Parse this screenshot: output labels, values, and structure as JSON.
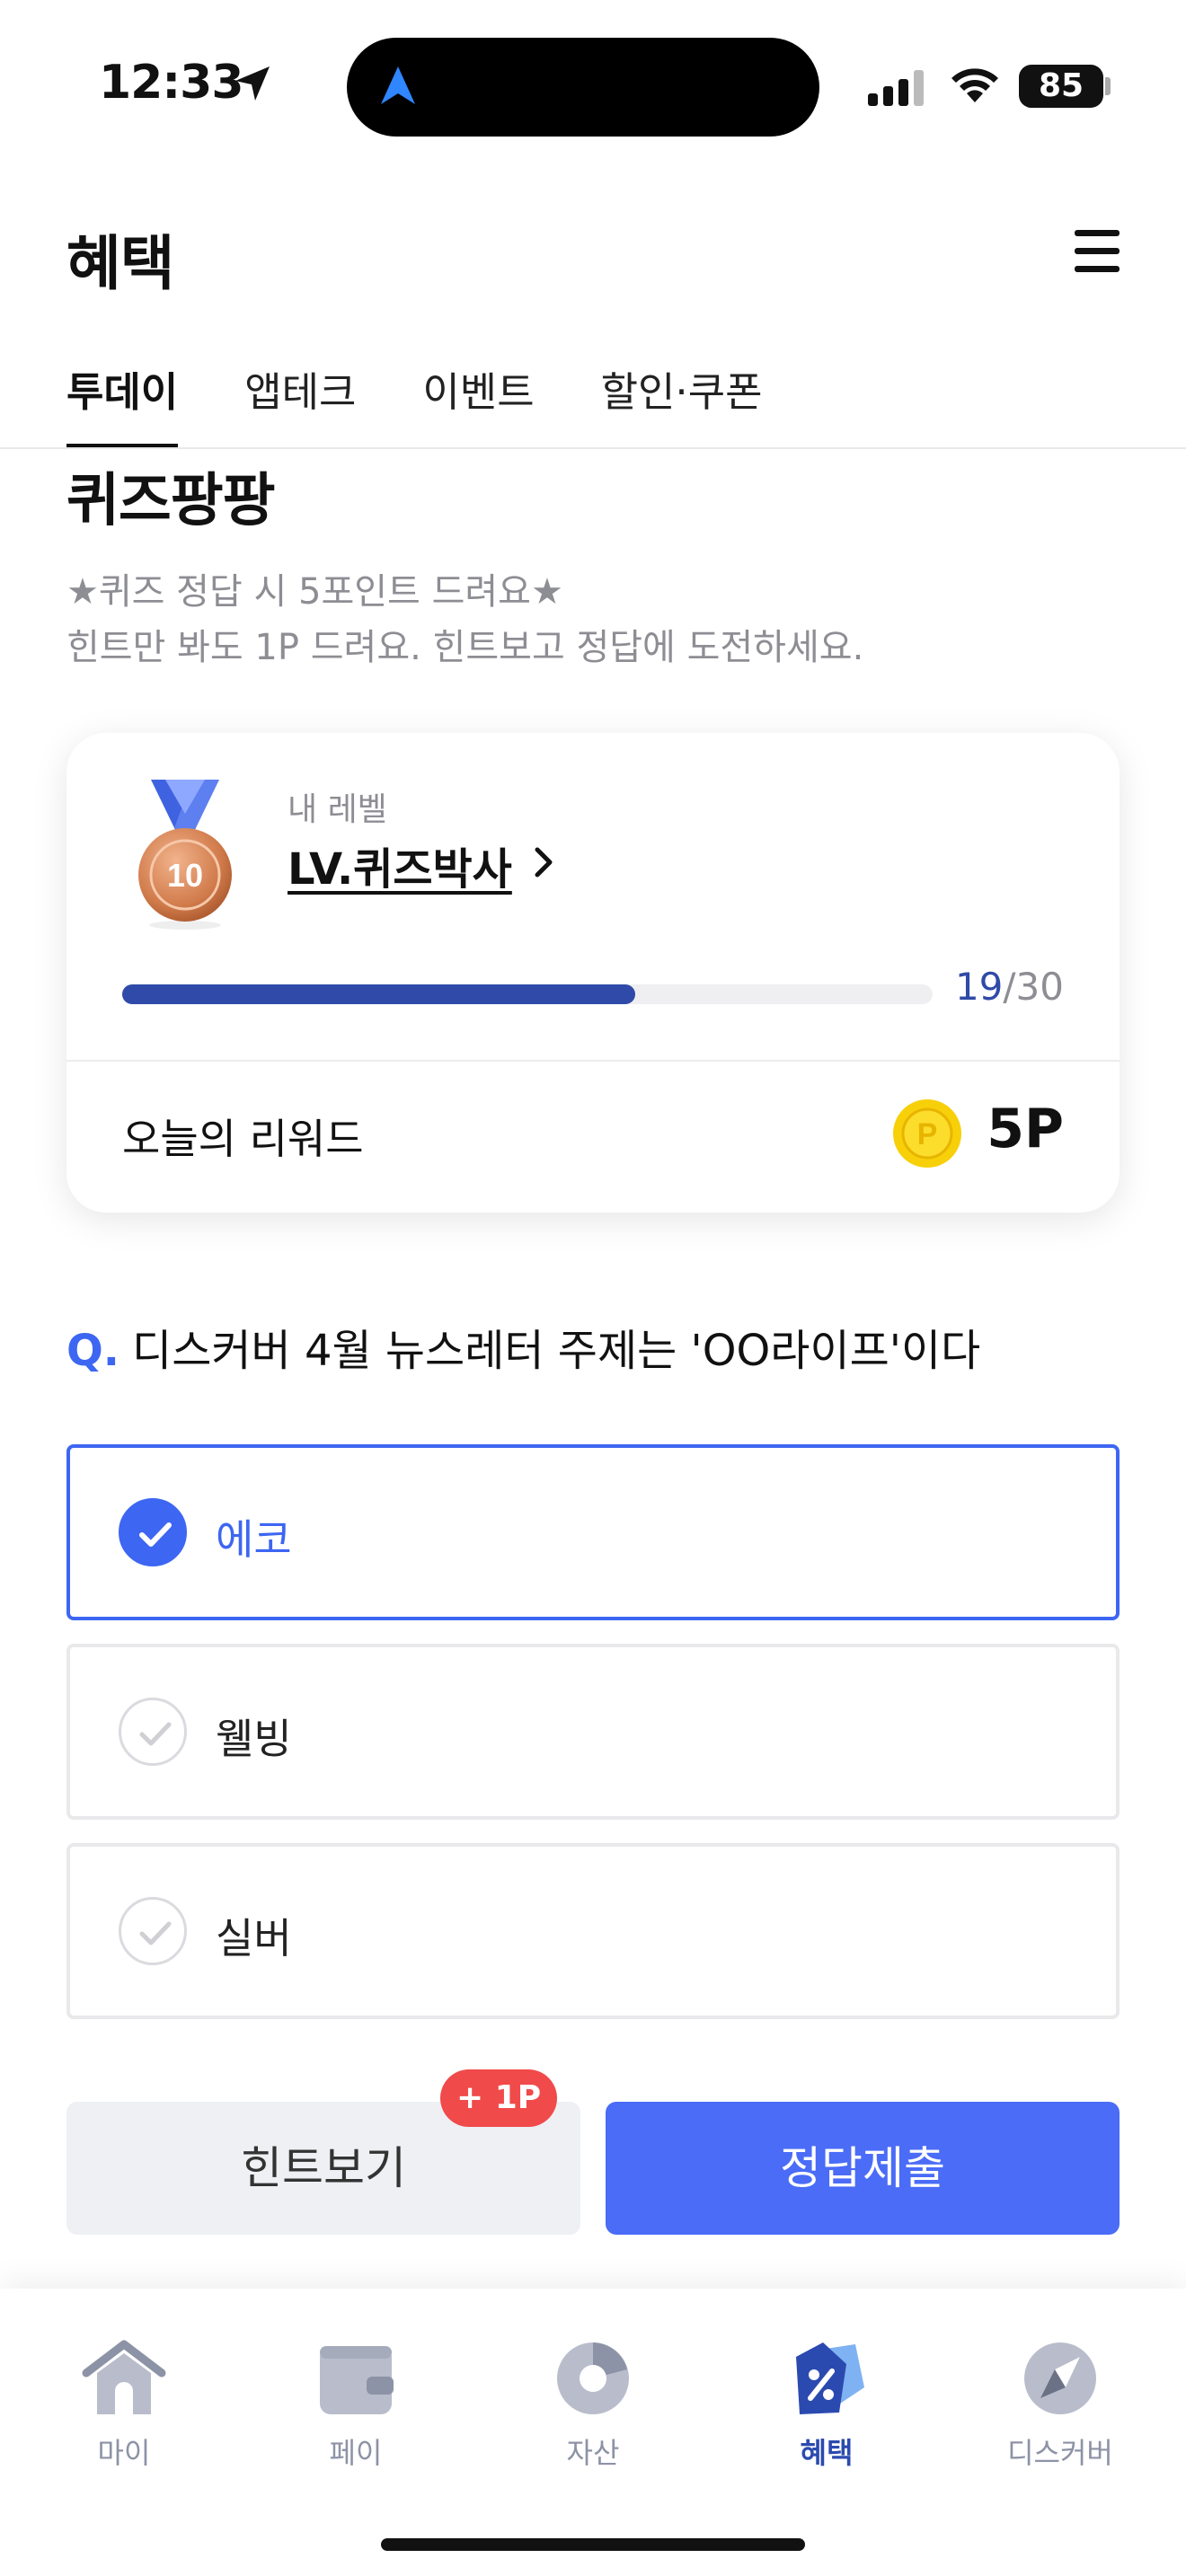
{
  "status_bar": {
    "time": "12:33",
    "battery": "85"
  },
  "header": {
    "title": "혜택"
  },
  "tabs": [
    {
      "label": "투데이"
    },
    {
      "label": "앱테크"
    },
    {
      "label": "이벤트"
    },
    {
      "label": "할인·쿠폰"
    }
  ],
  "section": {
    "title": "퀴즈팡팡",
    "desc_line1": "★퀴즈 정답 시 5포인트 드려요★",
    "desc_line2": "힌트만 봐도 1P 드려요. 힌트보고 정답에 도전하세요."
  },
  "level_card": {
    "medal_number": "10",
    "caption": "내 레벨",
    "level_name": "LV.퀴즈박사",
    "progress_current": "19",
    "progress_total": "/30",
    "progress_fraction": 0.633,
    "reward_label": "오늘의 리워드",
    "coin_symbol": "P",
    "reward_value": "5P"
  },
  "question": {
    "mark": "Q.",
    "text": "디스커버 4월 뉴스레터 주제는 'OO라이프'이다"
  },
  "options": [
    {
      "label": "에코",
      "selected": true
    },
    {
      "label": "웰빙",
      "selected": false
    },
    {
      "label": "실버",
      "selected": false
    }
  ],
  "buttons": {
    "hint": "힌트보기",
    "hint_badge": "+ 1P",
    "submit": "정답제출"
  },
  "bottom_nav": [
    {
      "label": "마이",
      "icon": "home-icon"
    },
    {
      "label": "페이",
      "icon": "wallet-icon"
    },
    {
      "label": "자산",
      "icon": "pie-chart-icon"
    },
    {
      "label": "혜택",
      "icon": "benefit-tag-icon",
      "active": true
    },
    {
      "label": "디스커버",
      "icon": "compass-icon"
    }
  ],
  "colors": {
    "accent": "#3d66f2",
    "submit": "#4a6cf7",
    "progress": "#2f4aa8",
    "badge": "#f04a4a",
    "nav_active": "#2b4ab0"
  }
}
